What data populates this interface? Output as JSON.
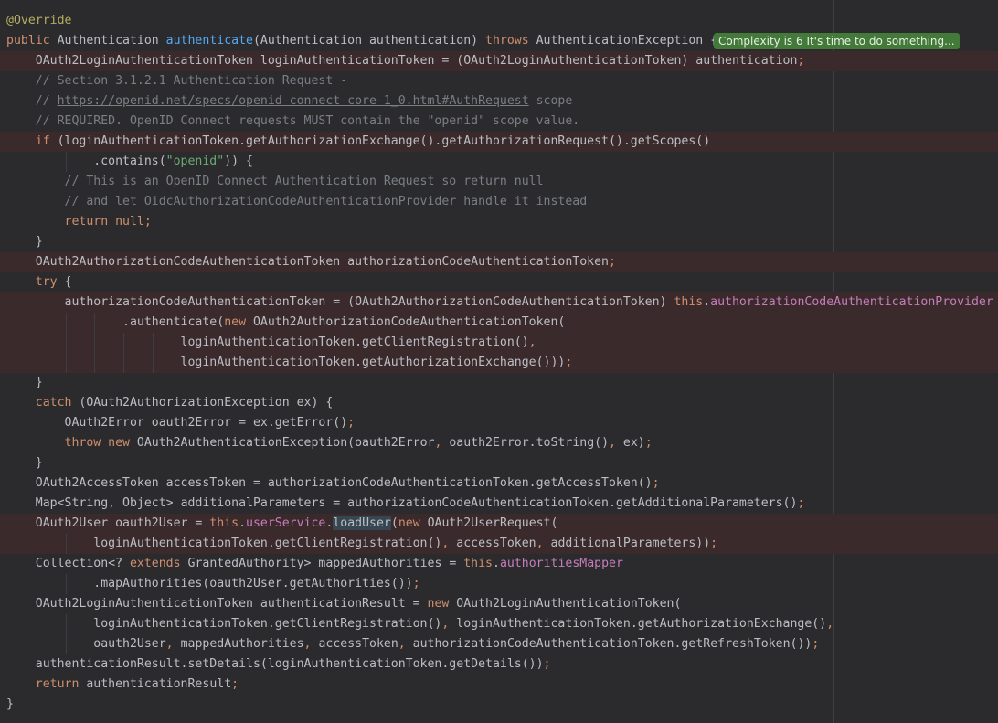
{
  "complexity_hint": "Complexity is 6 It's time to do something...",
  "lines": [
    {
      "segments": [
        [
          "ann",
          "@Override"
        ]
      ]
    },
    {
      "segments": [
        [
          "kw",
          "public "
        ],
        [
          "",
          "Authentication "
        ],
        [
          "fn",
          "authenticate"
        ],
        [
          "",
          "(Authentication authentication) "
        ],
        [
          "kw",
          "throws "
        ],
        [
          "",
          "AuthenticationException {"
        ]
      ]
    },
    {
      "highlight": true,
      "segments": [
        [
          "",
          "    OAuth2LoginAuthenticationToken loginAuthenticationToken = (OAuth2LoginAuthenticationToken) authentication"
        ],
        [
          "kw",
          ";"
        ]
      ]
    },
    {
      "segments": [
        [
          "cmt",
          "    // Section 3.1.2.1 Authentication Request -"
        ]
      ]
    },
    {
      "segments": [
        [
          "cmt",
          "    // "
        ],
        [
          "link",
          "https://openid.net/specs/openid-connect-core-1_0.html#AuthRequest"
        ],
        [
          "cmt",
          " scope"
        ]
      ]
    },
    {
      "segments": [
        [
          "cmt",
          "    // REQUIRED. OpenID Connect requests MUST contain the \"openid\" scope value."
        ]
      ]
    },
    {
      "highlight": true,
      "segments": [
        [
          "kw",
          "    if "
        ],
        [
          "",
          "(loginAuthenticationToken.getAuthorizationExchange().getAuthorizationRequest().getScopes()"
        ]
      ]
    },
    {
      "segments": [
        [
          "",
          "            .contains("
        ],
        [
          "str",
          "\"openid\""
        ],
        [
          "",
          ")) {"
        ]
      ]
    },
    {
      "segments": [
        [
          "cmt",
          "        // This is an OpenID Connect Authentication Request so return null"
        ]
      ]
    },
    {
      "segments": [
        [
          "cmt",
          "        // and let OidcAuthorizationCodeAuthenticationProvider handle it instead"
        ]
      ]
    },
    {
      "segments": [
        [
          "kw",
          "        return null;"
        ]
      ]
    },
    {
      "segments": [
        [
          "",
          "    }"
        ]
      ]
    },
    {
      "highlight": true,
      "segments": [
        [
          "",
          "    OAuth2AuthorizationCodeAuthenticationToken authorizationCodeAuthenticationToken"
        ],
        [
          "kw",
          ";"
        ]
      ]
    },
    {
      "segments": [
        [
          "kw",
          "    try "
        ],
        [
          "",
          "{"
        ]
      ]
    },
    {
      "highlight": true,
      "segments": [
        [
          "",
          "        authorizationCodeAuthenticationToken = (OAuth2AuthorizationCodeAuthenticationToken) "
        ],
        [
          "kw",
          "this"
        ],
        [
          "",
          "."
        ],
        [
          "fld",
          "authorizationCodeAuthenticationProvider"
        ]
      ]
    },
    {
      "highlight": true,
      "segments": [
        [
          "",
          "                .authenticate("
        ],
        [
          "kw",
          "new "
        ],
        [
          "",
          "OAuth2AuthorizationCodeAuthenticationToken("
        ]
      ]
    },
    {
      "highlight": true,
      "segments": [
        [
          "",
          "                        loginAuthenticationToken.getClientRegistration()"
        ],
        [
          "kw",
          ","
        ]
      ]
    },
    {
      "highlight": true,
      "segments": [
        [
          "",
          "                        loginAuthenticationToken.getAuthorizationExchange()))"
        ],
        [
          "kw",
          ";"
        ]
      ]
    },
    {
      "segments": [
        [
          "",
          "    }"
        ]
      ]
    },
    {
      "segments": [
        [
          "kw",
          "    catch "
        ],
        [
          "",
          "(OAuth2AuthorizationException ex) {"
        ]
      ]
    },
    {
      "segments": [
        [
          "",
          "        OAuth2Error oauth2Error = ex.getError()"
        ],
        [
          "kw",
          ";"
        ]
      ]
    },
    {
      "segments": [
        [
          "kw",
          "        throw new "
        ],
        [
          "",
          "OAuth2AuthenticationException(oauth2Error"
        ],
        [
          "kw",
          ", "
        ],
        [
          "",
          "oauth2Error.toString()"
        ],
        [
          "kw",
          ", "
        ],
        [
          "",
          "ex)"
        ],
        [
          "kw",
          ";"
        ]
      ]
    },
    {
      "segments": [
        [
          "",
          "    }"
        ]
      ]
    },
    {
      "segments": [
        [
          "",
          "    OAuth2AccessToken accessToken = authorizationCodeAuthenticationToken.getAccessToken()"
        ],
        [
          "kw",
          ";"
        ]
      ]
    },
    {
      "segments": [
        [
          "",
          "    Map<String"
        ],
        [
          "kw",
          ", "
        ],
        [
          "",
          "Object> additionalParameters = authorizationCodeAuthenticationToken.getAdditionalParameters()"
        ],
        [
          "kw",
          ";"
        ]
      ]
    },
    {
      "highlight": true,
      "segments": [
        [
          "",
          "    OAuth2User oauth2User = "
        ],
        [
          "kw",
          "this"
        ],
        [
          "",
          "."
        ],
        [
          "fld",
          "userService"
        ],
        [
          "",
          "."
        ],
        [
          "usage",
          "loadUser"
        ],
        [
          "",
          "("
        ],
        [
          "kw",
          "new "
        ],
        [
          "",
          "OAuth2UserRequest("
        ]
      ]
    },
    {
      "highlight": true,
      "segments": [
        [
          "",
          "            loginAuthenticationToken.getClientRegistration()"
        ],
        [
          "kw",
          ", "
        ],
        [
          "",
          "accessToken"
        ],
        [
          "kw",
          ", "
        ],
        [
          "",
          "additionalParameters))"
        ],
        [
          "kw",
          ";"
        ]
      ]
    },
    {
      "segments": [
        [
          "",
          "    Collection<? "
        ],
        [
          "kw",
          "extends "
        ],
        [
          "",
          "GrantedAuthority> mappedAuthorities = "
        ],
        [
          "kw",
          "this"
        ],
        [
          "",
          "."
        ],
        [
          "fld",
          "authoritiesMapper"
        ]
      ]
    },
    {
      "segments": [
        [
          "",
          "            .mapAuthorities(oauth2User.getAuthorities())"
        ],
        [
          "kw",
          ";"
        ]
      ]
    },
    {
      "segments": [
        [
          "",
          "    OAuth2LoginAuthenticationToken authenticationResult = "
        ],
        [
          "kw",
          "new "
        ],
        [
          "",
          "OAuth2LoginAuthenticationToken("
        ]
      ]
    },
    {
      "segments": [
        [
          "",
          "            loginAuthenticationToken.getClientRegistration()"
        ],
        [
          "kw",
          ", "
        ],
        [
          "",
          "loginAuthenticationToken.getAuthorizationExchange()"
        ],
        [
          "kw",
          ","
        ]
      ]
    },
    {
      "segments": [
        [
          "",
          "            oauth2User"
        ],
        [
          "kw",
          ", "
        ],
        [
          "",
          "mappedAuthorities"
        ],
        [
          "kw",
          ", "
        ],
        [
          "",
          "accessToken"
        ],
        [
          "kw",
          ", "
        ],
        [
          "",
          "authorizationCodeAuthenticationToken.getRefreshToken())"
        ],
        [
          "kw",
          ";"
        ]
      ]
    },
    {
      "segments": [
        [
          "",
          "    authenticationResult.setDetails(loginAuthenticationToken.getDetails())"
        ],
        [
          "kw",
          ";"
        ]
      ]
    },
    {
      "segments": [
        [
          "kw",
          "    return "
        ],
        [
          "",
          "authenticationResult"
        ],
        [
          "kw",
          ";"
        ]
      ]
    },
    {
      "segments": [
        [
          "",
          "}"
        ]
      ]
    }
  ]
}
